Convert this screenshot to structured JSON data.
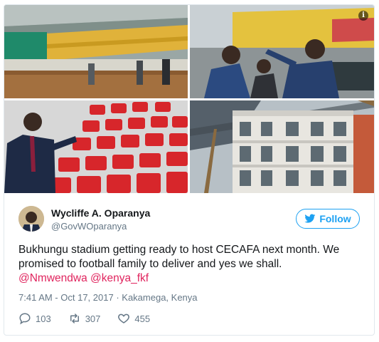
{
  "tweet": {
    "author_name": "Wycliffe A. Oparanya",
    "author_handle": "@GovWOparanya",
    "follow_label": "Follow",
    "text_line1": "Bukhungu stadium getting ready to host CECAFA next month. We",
    "text_line2": "promised to football family to deliver and yes we shall.",
    "mention1": "@Nmwendwa",
    "mention2": "@kenya_fkf",
    "timestamp": "7:41 AM - Oct 17, 2017",
    "location": "Kakamega, Kenya",
    "replies": "103",
    "retweets": "307",
    "likes": "455"
  },
  "media": {
    "photos": [
      "stadium-stands-photo",
      "officials-pointing-photo",
      "red-seats-photo",
      "stadium-building-photo"
    ],
    "info_icon": "i"
  },
  "icons": {
    "follow": "bird-icon",
    "reply": "reply-icon",
    "retweet": "retweet-icon",
    "like": "heart-icon"
  },
  "colors": {
    "accent": "#1da1f2",
    "mention": "#e0245e",
    "muted": "#657786"
  }
}
